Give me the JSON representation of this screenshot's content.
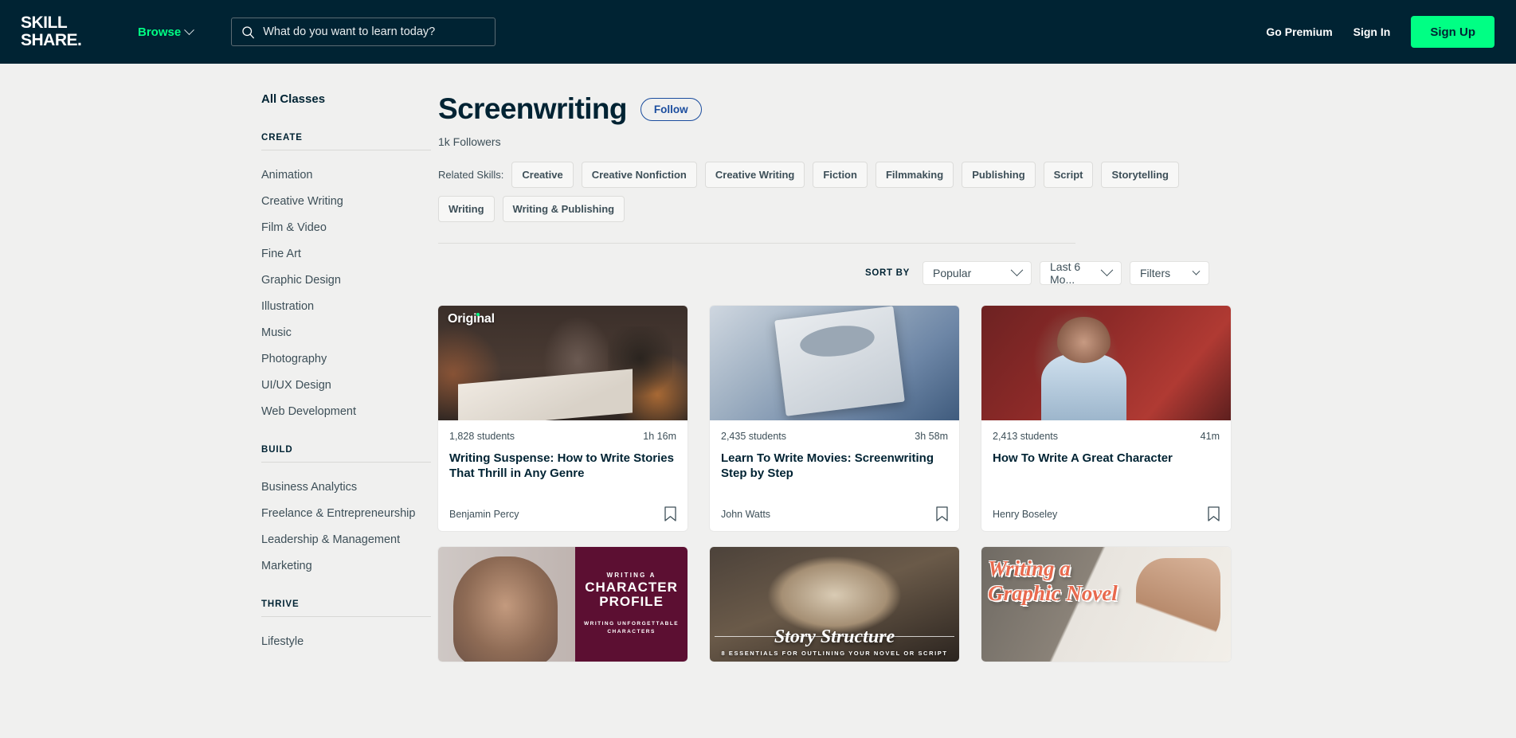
{
  "header": {
    "logo_line1": "SKILL",
    "logo_line2": "SHARE.",
    "browse_label": "Browse",
    "search_placeholder": "What do you want to learn today?",
    "search_value": "",
    "go_premium_label": "Go Premium",
    "sign_in_label": "Sign In",
    "sign_up_label": "Sign Up",
    "background_color": "#002333",
    "accent_color": "#00ff84"
  },
  "sidebar": {
    "all_classes_label": "All Classes",
    "groups": [
      {
        "title": "CREATE",
        "items": [
          {
            "label": "Animation"
          },
          {
            "label": "Creative Writing"
          },
          {
            "label": "Film & Video"
          },
          {
            "label": "Fine Art"
          },
          {
            "label": "Graphic Design"
          },
          {
            "label": "Illustration"
          },
          {
            "label": "Music"
          },
          {
            "label": "Photography"
          },
          {
            "label": "UI/UX Design"
          },
          {
            "label": "Web Development"
          }
        ]
      },
      {
        "title": "BUILD",
        "items": [
          {
            "label": "Business Analytics"
          },
          {
            "label": "Freelance & Entrepreneurship"
          },
          {
            "label": "Leadership & Management"
          },
          {
            "label": "Marketing"
          }
        ]
      },
      {
        "title": "THRIVE",
        "items": [
          {
            "label": "Lifestyle"
          }
        ]
      }
    ]
  },
  "main": {
    "title": "Screenwriting",
    "follow_label": "Follow",
    "followers": "1k Followers",
    "related_skills_label": "Related Skills:",
    "related_skills": [
      "Creative",
      "Creative Nonfiction",
      "Creative Writing",
      "Fiction",
      "Filmmaking",
      "Publishing",
      "Script",
      "Storytelling",
      "Writing",
      "Writing & Publishing"
    ],
    "sort": {
      "label": "SORT BY",
      "sort_value": "Popular",
      "time_value": "Last 6 Mo...",
      "filters_value": "Filters"
    },
    "cards": [
      {
        "badge": "Original",
        "students": "1,828 students",
        "duration": "1h 16m",
        "title": "Writing Suspense: How to Write Stories That Thrill in Any Genre",
        "author": "Benjamin Percy",
        "thumb_class": "th1",
        "thumb_text": {}
      },
      {
        "badge": "",
        "students": "2,435 students",
        "duration": "3h 58m",
        "title": "Learn To Write Movies: Screenwriting Step by Step",
        "author": "John Watts",
        "thumb_class": "th2",
        "thumb_text": {}
      },
      {
        "badge": "",
        "students": "2,413 students",
        "duration": "41m",
        "title": "How To Write A Great Character",
        "author": "Henry Boseley",
        "thumb_class": "th3",
        "thumb_text": {}
      },
      {
        "badge": "",
        "students": "",
        "duration": "",
        "title": "",
        "author": "",
        "thumb_class": "th4",
        "thumb_text": {
          "line1": "WRITING A",
          "line2": "CHARACTER PROFILE",
          "line3": "WRITING UNFORGETTABLE CHARACTERS"
        }
      },
      {
        "badge": "",
        "students": "",
        "duration": "",
        "title": "",
        "author": "",
        "thumb_class": "th5",
        "thumb_text": {
          "line1": "Story Structure",
          "line2": "8 ESSENTIALS FOR OUTLINING YOUR NOVEL OR SCRIPT"
        }
      },
      {
        "badge": "",
        "students": "",
        "duration": "",
        "title": "",
        "author": "",
        "thumb_class": "th6",
        "thumb_text": {
          "line1": "Writing a",
          "line2": "Graphic Novel"
        }
      }
    ]
  }
}
